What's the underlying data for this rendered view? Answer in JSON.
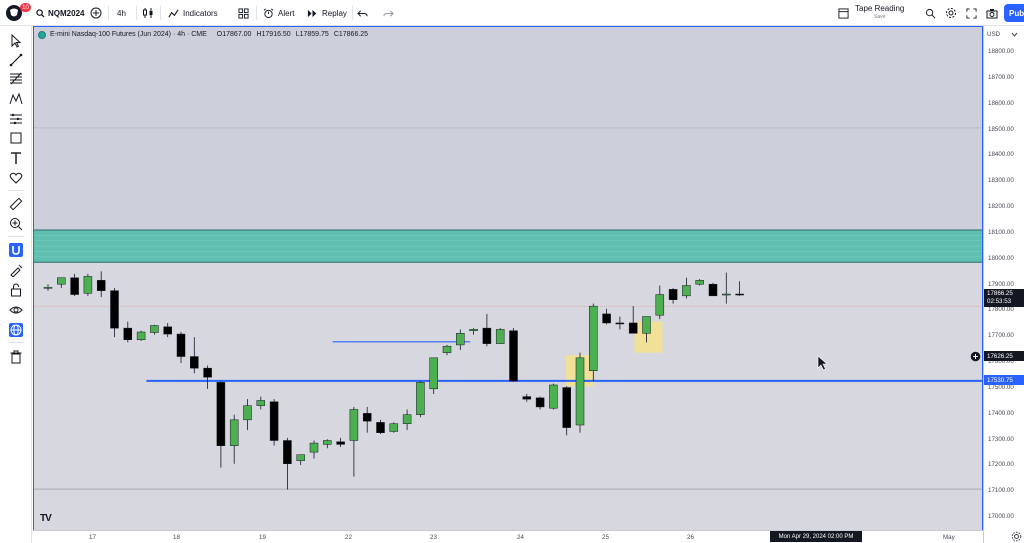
{
  "toolbar": {
    "notifications": "10",
    "symbol": "NQM2024",
    "interval": "4h",
    "indicators": "Indicators",
    "alert": "Alert",
    "replay": "Replay",
    "layout_name": "Tape Reading",
    "layout_status": "Save",
    "publish": "Pub"
  },
  "legend": {
    "title": "E-mini Nasdaq-100 Futures (Jun 2024) · 4h · CME",
    "open": "O17867.00",
    "high": "H17916.50",
    "low": "L17859.75",
    "close": "C17866.25"
  },
  "price_axis": {
    "currency": "USD",
    "ticks": [
      "18800.00",
      "18700.00",
      "18600.00",
      "18500.00",
      "18400.00",
      "18300.00",
      "18200.00",
      "18100.00",
      "18000.00",
      "17900.00",
      "17800.00",
      "17700.00",
      "17600.00",
      "17500.00",
      "17400.00",
      "17300.00",
      "17200.00",
      "17100.00",
      "17000.00"
    ],
    "last_price": "17866.25",
    "countdown": "02:53:53",
    "crosshair_price": "17626.25",
    "line_price": "17530.75"
  },
  "time_axis": {
    "labels": [
      "17",
      "18",
      "19",
      "22",
      "23",
      "24",
      "25",
      "26",
      "May"
    ],
    "crosshair_date": "Mon Apr 29, 2024   02:00 PM"
  },
  "watermark": "TV",
  "chart_data": {
    "type": "candlestick",
    "title": "E-mini Nasdaq-100 Futures (Jun 2024) · 4h · CME",
    "ylim": [
      16950,
      18900
    ],
    "colors": {
      "up": "#4caf50",
      "down": "#000000",
      "zone": "#5fbfb1",
      "line": "#2962ff",
      "highlight": "#f5e28c"
    },
    "zone": {
      "low": 17990,
      "high": 18115
    },
    "horizontal_lines": [
      {
        "price": 17530.75,
        "from_index": 8
      },
      {
        "price": 17682,
        "from_index": 22,
        "to_index": 31
      }
    ],
    "candles": [
      {
        "o": 17890,
        "h": 17905,
        "l": 17880,
        "c": 17893
      },
      {
        "o": 17905,
        "h": 17920,
        "l": 17890,
        "c": 17930
      },
      {
        "o": 17930,
        "h": 17945,
        "l": 17860,
        "c": 17865
      },
      {
        "o": 17870,
        "h": 17945,
        "l": 17860,
        "c": 17935
      },
      {
        "o": 17920,
        "h": 17955,
        "l": 17855,
        "c": 17880
      },
      {
        "o": 17880,
        "h": 17890,
        "l": 17700,
        "c": 17735
      },
      {
        "o": 17735,
        "h": 17760,
        "l": 17680,
        "c": 17690
      },
      {
        "o": 17690,
        "h": 17725,
        "l": 17685,
        "c": 17720
      },
      {
        "o": 17718,
        "h": 17748,
        "l": 17710,
        "c": 17745
      },
      {
        "o": 17740,
        "h": 17755,
        "l": 17700,
        "c": 17712
      },
      {
        "o": 17712,
        "h": 17720,
        "l": 17600,
        "c": 17625
      },
      {
        "o": 17625,
        "h": 17700,
        "l": 17560,
        "c": 17580
      },
      {
        "o": 17580,
        "h": 17590,
        "l": 17500,
        "c": 17545
      },
      {
        "o": 17525,
        "h": 17530,
        "l": 17195,
        "c": 17280
      },
      {
        "o": 17280,
        "h": 17400,
        "l": 17210,
        "c": 17380
      },
      {
        "o": 17380,
        "h": 17460,
        "l": 17340,
        "c": 17435
      },
      {
        "o": 17435,
        "h": 17470,
        "l": 17420,
        "c": 17455
      },
      {
        "o": 17450,
        "h": 17460,
        "l": 17280,
        "c": 17300
      },
      {
        "o": 17300,
        "h": 17310,
        "l": 17110,
        "c": 17210
      },
      {
        "o": 17222,
        "h": 17240,
        "l": 17205,
        "c": 17245
      },
      {
        "o": 17255,
        "h": 17300,
        "l": 17230,
        "c": 17290
      },
      {
        "o": 17285,
        "h": 17305,
        "l": 17270,
        "c": 17300
      },
      {
        "o": 17295,
        "h": 17310,
        "l": 17275,
        "c": 17285
      },
      {
        "o": 17300,
        "h": 17430,
        "l": 17160,
        "c": 17420
      },
      {
        "o": 17405,
        "h": 17430,
        "l": 17330,
        "c": 17375
      },
      {
        "o": 17370,
        "h": 17380,
        "l": 17325,
        "c": 17330
      },
      {
        "o": 17335,
        "h": 17370,
        "l": 17330,
        "c": 17365
      },
      {
        "o": 17365,
        "h": 17420,
        "l": 17340,
        "c": 17400
      },
      {
        "o": 17400,
        "h": 17530,
        "l": 17390,
        "c": 17525
      },
      {
        "o": 17500,
        "h": 17590,
        "l": 17480,
        "c": 17620
      },
      {
        "o": 17640,
        "h": 17670,
        "l": 17630,
        "c": 17665
      },
      {
        "o": 17670,
        "h": 17730,
        "l": 17650,
        "c": 17715
      },
      {
        "o": 17725,
        "h": 17735,
        "l": 17710,
        "c": 17730
      },
      {
        "o": 17735,
        "h": 17790,
        "l": 17665,
        "c": 17675
      },
      {
        "o": 17675,
        "h": 17735,
        "l": 17680,
        "c": 17730
      },
      {
        "o": 17725,
        "h": 17735,
        "l": 17530,
        "c": 17530
      },
      {
        "o": 17470,
        "h": 17480,
        "l": 17450,
        "c": 17460
      },
      {
        "o": 17465,
        "h": 17470,
        "l": 17420,
        "c": 17430
      },
      {
        "o": 17425,
        "h": 17520,
        "l": 17420,
        "c": 17515
      },
      {
        "o": 17505,
        "h": 17510,
        "l": 17320,
        "c": 17350
      },
      {
        "o": 17360,
        "h": 17640,
        "l": 17330,
        "c": 17620
      },
      {
        "o": 17570,
        "h": 17830,
        "l": 17530,
        "c": 17820
      },
      {
        "o": 17790,
        "h": 17810,
        "l": 17750,
        "c": 17755
      },
      {
        "o": 17755,
        "h": 17780,
        "l": 17730,
        "c": 17752
      },
      {
        "o": 17755,
        "h": 17820,
        "l": 17720,
        "c": 17715
      },
      {
        "o": 17715,
        "h": 17780,
        "l": 17680,
        "c": 17780
      },
      {
        "o": 17785,
        "h": 17900,
        "l": 17770,
        "c": 17865
      },
      {
        "o": 17885,
        "h": 17890,
        "l": 17830,
        "c": 17845
      },
      {
        "o": 17860,
        "h": 17930,
        "l": 17850,
        "c": 17900
      },
      {
        "o": 17905,
        "h": 17925,
        "l": 17900,
        "c": 17920
      },
      {
        "o": 17905,
        "h": 17910,
        "l": 17860,
        "c": 17860
      },
      {
        "o": 17865,
        "h": 17950,
        "l": 17830,
        "c": 17867
      },
      {
        "o": 17867,
        "h": 17916.5,
        "l": 17859.75,
        "c": 17866.25
      }
    ]
  }
}
